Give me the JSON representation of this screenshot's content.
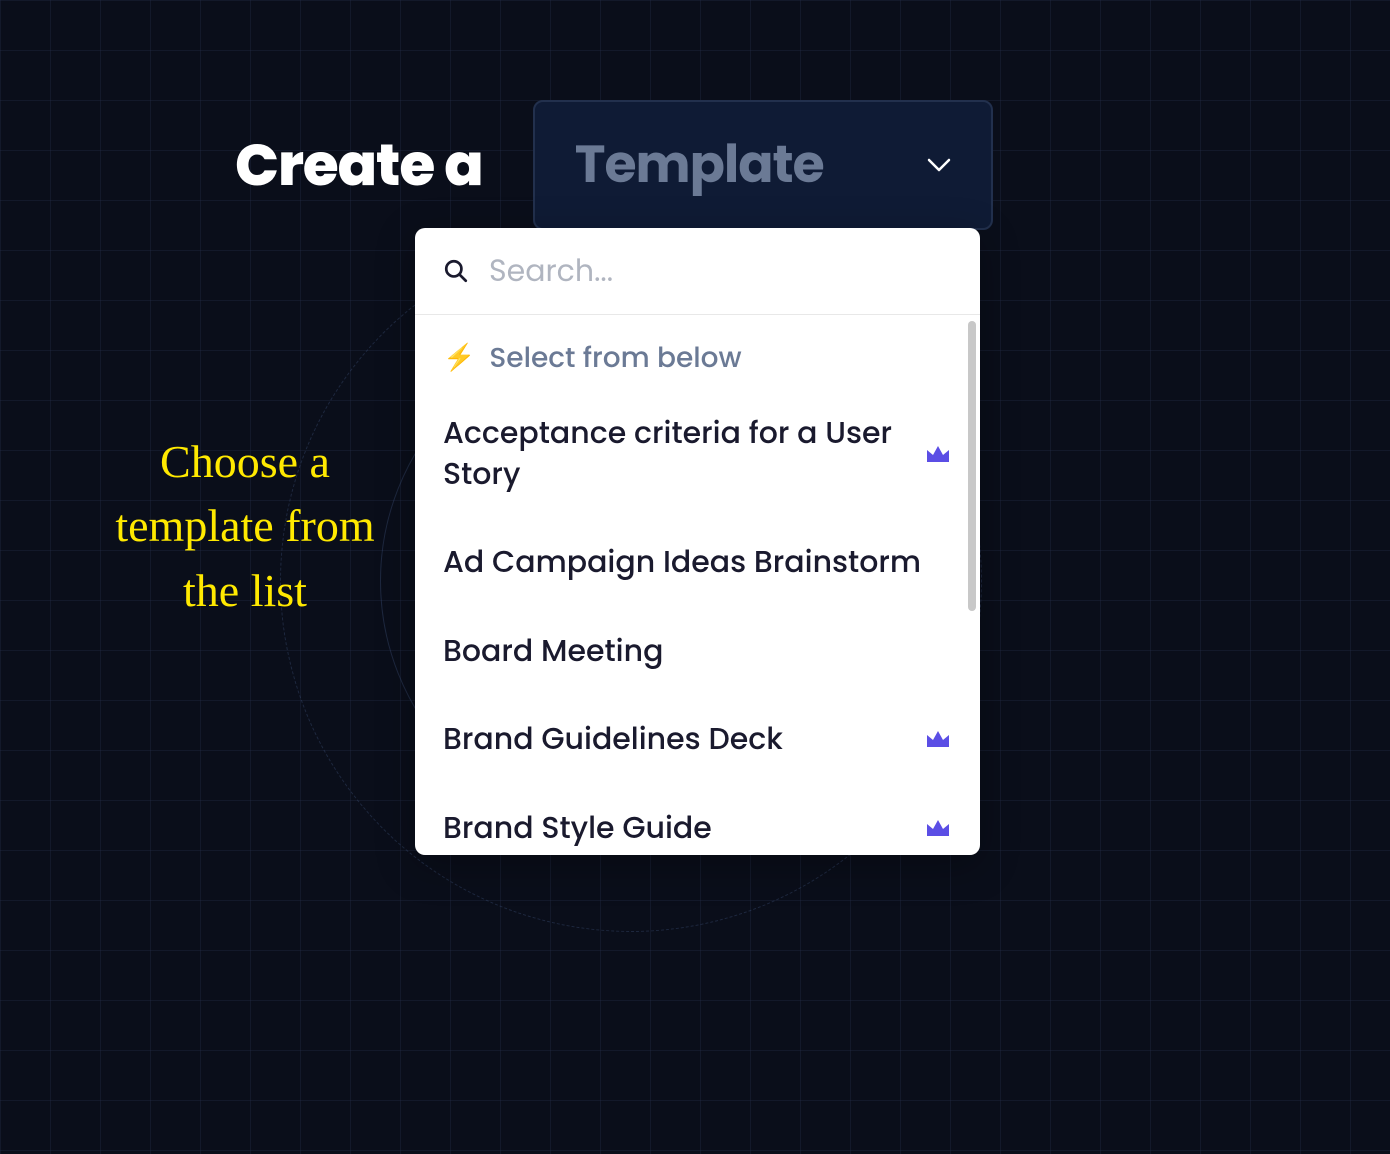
{
  "header": {
    "create_label": "Create a",
    "dropdown_label": "Template"
  },
  "annotation": {
    "text": "Choose a template from the list"
  },
  "search": {
    "placeholder": "Search..."
  },
  "hint": {
    "label": "Select from below"
  },
  "list": {
    "items": [
      {
        "label": "Acceptance criteria for a User Story",
        "premium": true
      },
      {
        "label": "Ad Campaign Ideas Brainstorm",
        "premium": false
      },
      {
        "label": "Board Meeting",
        "premium": false
      },
      {
        "label": "Brand Guidelines Deck",
        "premium": true
      },
      {
        "label": "Brand Style Guide",
        "premium": true
      }
    ]
  }
}
